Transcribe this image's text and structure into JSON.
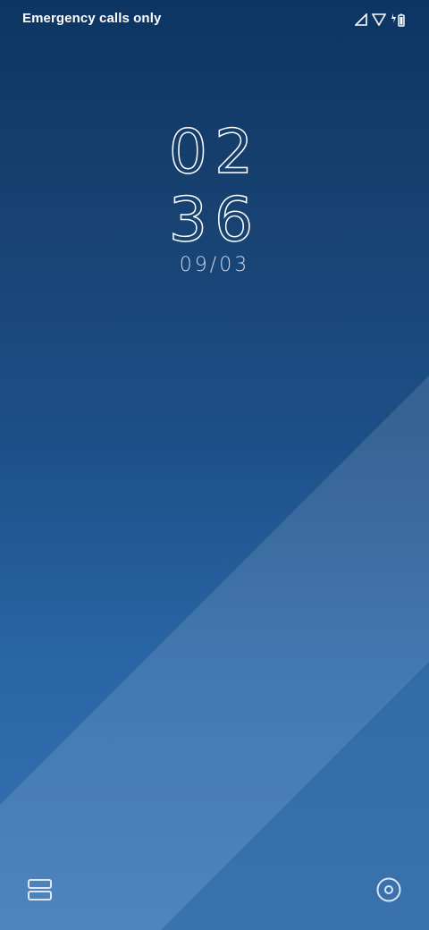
{
  "status_bar": {
    "carrier_text": "Emergency calls only",
    "icons": [
      "signal-icon",
      "wifi-icon",
      "battery-charging-icon"
    ]
  },
  "lockscreen": {
    "hour": "02",
    "minute": "36",
    "date": "09/03"
  },
  "bottom": {
    "left_icon": "recents-icon",
    "right_icon": "camera-icon"
  },
  "colors": {
    "top_background": "#0d3563",
    "bottom_background": "#3873b3",
    "text": "#ffffff"
  }
}
